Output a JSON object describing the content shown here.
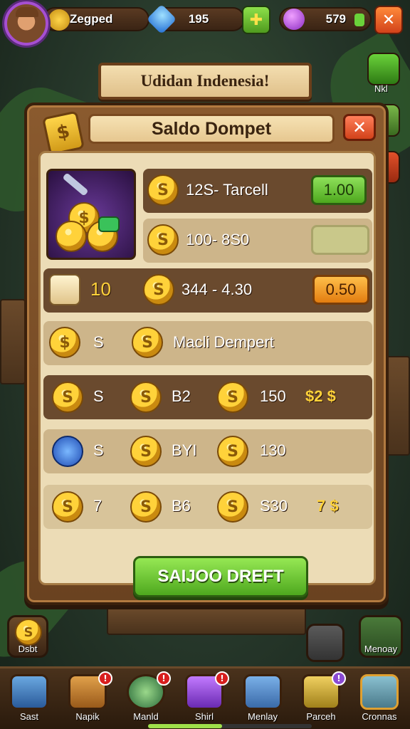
{
  "hud": {
    "player_name": "Zegped",
    "gems": "195",
    "coins": "579"
  },
  "banner": {
    "title": "Udidan Indenesia!"
  },
  "panel": {
    "title": "Saldo Dompet",
    "close_label": "✕",
    "rows": [
      {
        "label": "12S- Tarcell",
        "button": "1.00"
      },
      {
        "label": "100- 8S0",
        "button": ""
      },
      {
        "count": "10",
        "label": "344 - 4.30",
        "button": "0.50"
      },
      {
        "left": "S",
        "label": "Macli Dempert"
      },
      {
        "left": "S",
        "mid": "B2",
        "right": "150",
        "extra": "$2 $"
      },
      {
        "left": "S",
        "mid": "BYI",
        "right": "130"
      },
      {
        "left": "7",
        "mid": "B6",
        "right": "S30",
        "extra": "7 $"
      }
    ],
    "action_button": "SAIJOO DREFT"
  },
  "side": {
    "top_label": "Nkl",
    "left_bottom_label": "Dsbt",
    "right_bottom_label": "Menoay"
  },
  "nav": [
    {
      "label": "Sast",
      "badge": ""
    },
    {
      "label": "Napik",
      "badge": "!"
    },
    {
      "label": "Manld",
      "badge": "!"
    },
    {
      "label": "Shirl",
      "badge": "!"
    },
    {
      "label": "Menlay",
      "badge": ""
    },
    {
      "label": "Parceh",
      "badge": "!"
    },
    {
      "label": "Cronnas",
      "badge": ""
    }
  ],
  "colors": {
    "accent_green": "#4ea81e",
    "accent_orange": "#e27d10",
    "wood": "#6a4220",
    "parchment": "#ecdcb6"
  },
  "progress": {
    "fraction": 0.45
  }
}
